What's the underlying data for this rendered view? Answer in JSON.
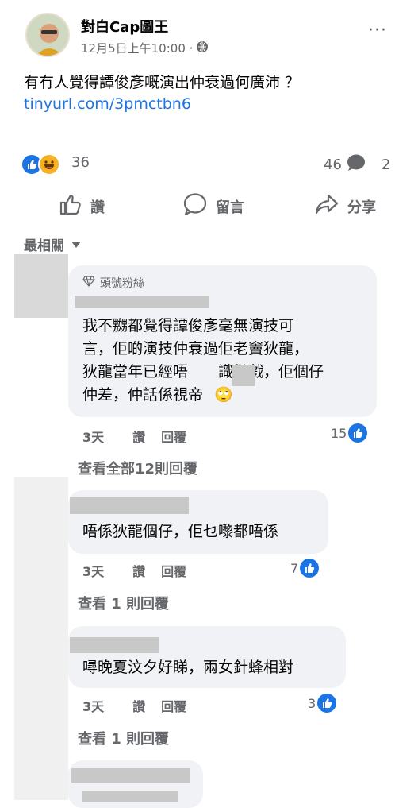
{
  "post": {
    "author": "對白Cap圖王",
    "time": "12月5日上午10:00 ·",
    "text": "有冇人覺得譚俊彥嘅演出仲衰過何廣沛 ？",
    "link": "tinyurl.com/3pmctbn6",
    "reaction_count": "36",
    "comment_count": "46",
    "share_count": "2"
  },
  "actions": {
    "like": "讚",
    "comment": "留言",
    "share": "分享"
  },
  "sort_label": "最相關",
  "comments": [
    {
      "badge": "頭號粉絲",
      "text_lines": [
        "我不嬲都覺得譚俊彥毫無演技可",
        "言，佢啲演技仲衰過佢老竇狄龍，",
        "狄龍當年已經唔　　識做戲，佢個仔",
        "仲差，仲話係視帝"
      ],
      "emoji": "🙄",
      "time": "3天",
      "like_label": "讚",
      "reply_label": "回覆",
      "likes": "15",
      "view_replies": "查看全部12則回覆"
    },
    {
      "text_lines": [
        "唔係狄龍個仔，佢乜嚟都唔係"
      ],
      "time": "3天",
      "like_label": "讚",
      "reply_label": "回覆",
      "likes": "7",
      "view_replies": "查看 1 則回覆"
    },
    {
      "text_lines": [
        "噚晚夏汶夕好睇，兩女針蜂相對"
      ],
      "time": "3天",
      "like_label": "讚",
      "reply_label": "回覆",
      "likes": "3",
      "view_replies": "查看 1 則回覆"
    }
  ],
  "colors": {
    "accent": "#1b74e4",
    "secondary_text": "#65676b",
    "bubble": "#f0f2f5"
  }
}
